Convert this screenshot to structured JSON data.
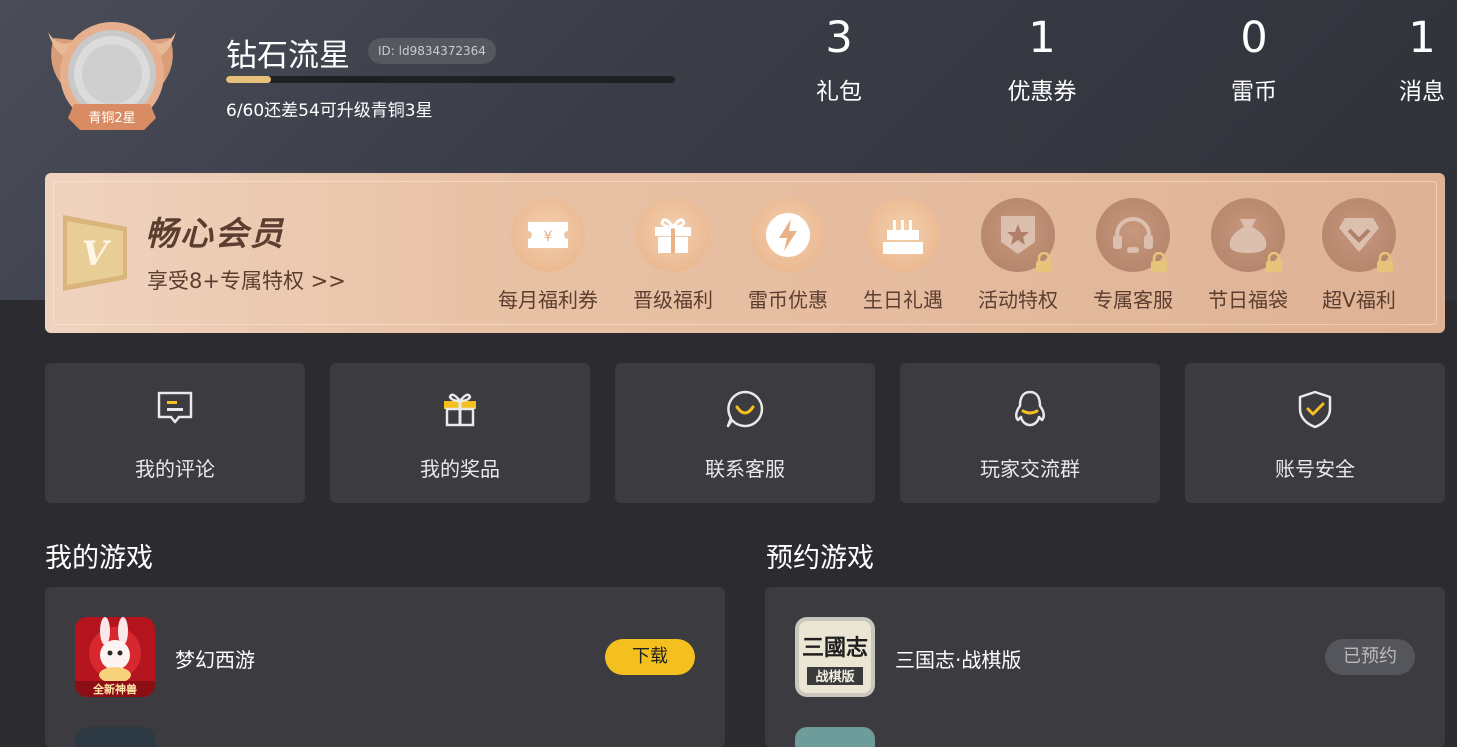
{
  "profile": {
    "username": "钻石流星",
    "user_id": "ID: ld9834372364",
    "badge_text": "青铜2星",
    "level_progress": 0.1,
    "level_text": "6/60还差54可升级青铜3星"
  },
  "stats": [
    {
      "value": "3",
      "label": "礼包"
    },
    {
      "value": "1",
      "label": "优惠券"
    },
    {
      "value": "0",
      "label": "雷币"
    },
    {
      "value": "1",
      "label": "消息"
    }
  ],
  "vip": {
    "badge_letter": "V",
    "title": "畅心会员",
    "subtitle": "享受8+专属特权 >>",
    "perks": [
      {
        "label": "每月福利券",
        "icon": "ticket-icon",
        "locked": false
      },
      {
        "label": "晋级福利",
        "icon": "gift-icon",
        "locked": false
      },
      {
        "label": "雷币优惠",
        "icon": "lightning-icon",
        "locked": false
      },
      {
        "label": "生日礼遇",
        "icon": "cake-icon",
        "locked": false
      },
      {
        "label": "活动特权",
        "icon": "star-badge-icon",
        "locked": true
      },
      {
        "label": "专属客服",
        "icon": "headset-icon",
        "locked": true
      },
      {
        "label": "节日福袋",
        "icon": "money-bag-icon",
        "locked": true
      },
      {
        "label": "超V福利",
        "icon": "diamond-icon",
        "locked": true
      }
    ]
  },
  "quick_actions": [
    {
      "label": "我的评论",
      "icon": "comment-icon"
    },
    {
      "label": "我的奖品",
      "icon": "gift-icon"
    },
    {
      "label": "联系客服",
      "icon": "chat-smile-icon"
    },
    {
      "label": "玩家交流群",
      "icon": "qq-penguin-icon"
    },
    {
      "label": "账号安全",
      "icon": "shield-check-icon"
    }
  ],
  "my_games": {
    "title": "我的游戏",
    "items": [
      {
        "name": "梦幻西游",
        "icon_caption": "全新神兽",
        "action": "下载"
      }
    ]
  },
  "reserved_games": {
    "title": "预约游戏",
    "items": [
      {
        "name": "三国志·战棋版",
        "icon_title": "三國志",
        "icon_caption": "战棋版",
        "action": "已预约"
      }
    ]
  },
  "colors": {
    "accent_yellow": "#f3c01f",
    "vip_gold": "#e9c2a6",
    "tile_bg": "#3b3b40"
  }
}
